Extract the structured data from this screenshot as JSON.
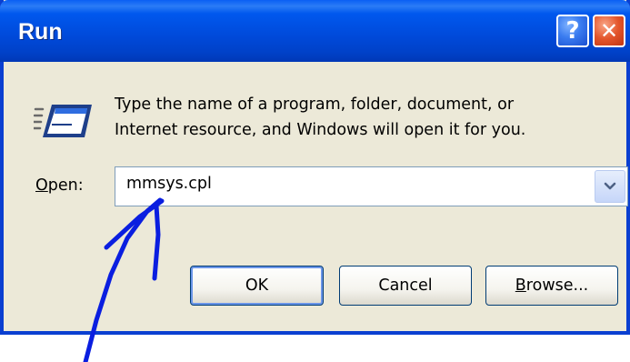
{
  "window": {
    "title": "Run",
    "help_glyph": "?",
    "close_glyph": "✕"
  },
  "description": {
    "line1": "Type the name of a program, folder, document, or",
    "line2": "Internet resource, and Windows will open it for you."
  },
  "open_field": {
    "label_accel": "O",
    "label_rest": "pen:",
    "value": "mmsys.cpl"
  },
  "buttons": {
    "ok_label": "OK",
    "cancel_label": "Cancel",
    "browse_accel": "B",
    "browse_rest": "rowse..."
  },
  "icons": {
    "run": "run-program-icon",
    "dropdown": "chevron-down-icon",
    "help": "help-icon",
    "close": "close-icon"
  },
  "colors": {
    "titlebar": "#0054e3",
    "dialog_bg": "#ece9d8",
    "annotation_arrow": "#0a1ee0",
    "close_button": "#e3552b"
  }
}
